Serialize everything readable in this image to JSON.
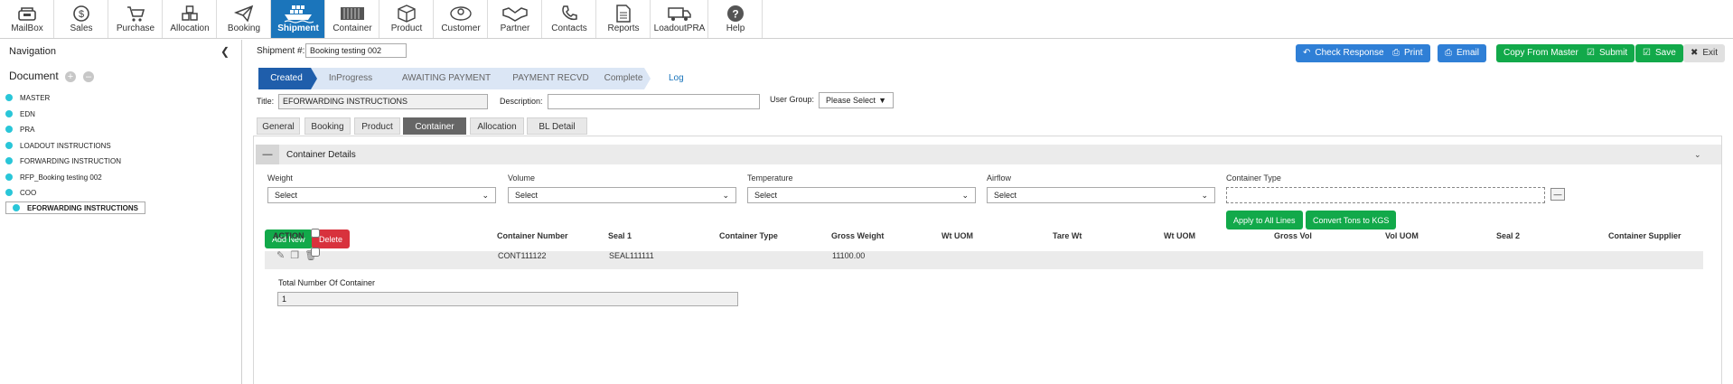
{
  "nav": [
    {
      "label": "MailBox",
      "icon": "mailbox-icon"
    },
    {
      "label": "Sales",
      "icon": "dollar-icon"
    },
    {
      "label": "Purchase",
      "icon": "cart-icon"
    },
    {
      "label": "Allocation",
      "icon": "allocation-icon"
    },
    {
      "label": "Booking",
      "icon": "paper-plane-icon"
    },
    {
      "label": "Shipment",
      "icon": "ship-icon",
      "active": true
    },
    {
      "label": "Container",
      "icon": "container-icon"
    },
    {
      "label": "Product",
      "icon": "box-icon"
    },
    {
      "label": "Customer",
      "icon": "customer-icon"
    },
    {
      "label": "Partner",
      "icon": "handshake-icon"
    },
    {
      "label": "Contacts",
      "icon": "phone-icon"
    },
    {
      "label": "Reports",
      "icon": "report-icon"
    },
    {
      "label": "LoadoutPRA",
      "icon": "truck-icon"
    },
    {
      "label": "Help",
      "icon": "help-icon"
    }
  ],
  "sidebar": {
    "title": "Navigation",
    "document_title": "Document",
    "items": [
      "MASTER",
      "EDN",
      "PRA",
      "LOADOUT INSTRUCTIONS",
      "FORWARDING INSTRUCTION",
      "RFP_Booking testing 002",
      "COO",
      "EFORWARDING INSTRUCTIONS"
    ],
    "selected": "EFORWARDING INSTRUCTIONS"
  },
  "header": {
    "shipment_label": "Shipment #:",
    "shipment_value": "Booking testing 002",
    "actions": {
      "check_response": "Check Response",
      "print": "Print",
      "email": "Email",
      "copy_from_master": "Copy From Master",
      "submit": "Submit",
      "save": "Save",
      "exit": "Exit"
    }
  },
  "workflow": {
    "steps": [
      "Created",
      "InProgress",
      "AWAITING PAYMENT",
      "PAYMENT RECVD",
      "Complete"
    ],
    "current": "Created",
    "log": "Log"
  },
  "form": {
    "title_label": "Title:",
    "title_value": "EFORWARDING INSTRUCTIONS",
    "description_label": "Description:",
    "description_value": "",
    "user_group_label": "User Group:",
    "user_group_value": "Please Select"
  },
  "tabs": [
    "General",
    "Booking",
    "Product",
    "Container",
    "Allocation",
    "BL Detail"
  ],
  "active_tab": "Container",
  "container_details": {
    "title": "Container Details",
    "filters": [
      {
        "label": "Weight",
        "value": "Select"
      },
      {
        "label": "Volume",
        "value": "Select"
      },
      {
        "label": "Temperature",
        "value": "Select"
      },
      {
        "label": "Airflow",
        "value": "Select"
      }
    ],
    "container_type_label": "Container Type",
    "apply_all": "Apply to All Lines",
    "convert_tons": "Convert Tons to KGS",
    "add_new": "Add New",
    "delete": "Delete",
    "columns": [
      "ACTION",
      "",
      "Container Number",
      "Seal 1",
      "Container Type",
      "Gross Weight",
      "Wt UOM",
      "Tare Wt",
      "Wt UOM",
      "Gross Vol",
      "Vol UOM",
      "Seal 2",
      "Container Supplier"
    ],
    "rows": [
      {
        "container_number": "CONT111122",
        "seal1": "SEAL111111",
        "container_type": "",
        "gross_weight": "11100.00"
      }
    ],
    "total_label": "Total Number Of Container",
    "total_value": "1"
  },
  "colors": {
    "primary": "#1b75bb",
    "step_active": "#1f5eab",
    "step": "#dbe6f5",
    "green": "#12a94a",
    "blue": "#2f7fd6",
    "red": "#d8323d",
    "dot": "#29c6d8"
  }
}
